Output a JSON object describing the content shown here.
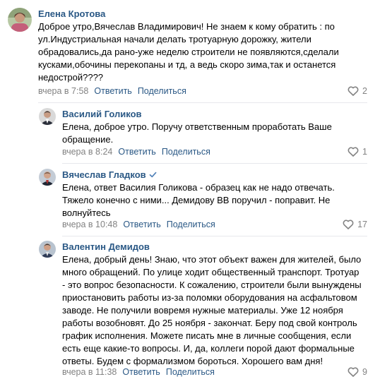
{
  "comments": [
    {
      "author": "Елена Кротова",
      "lines": [
        "Доброе утро,Вячеслав Владимирович! Не знаем к кому обратить : по",
        "ул.Индустриальная начали делать тротуарную дорожку, жители",
        "обрадовались,да рано-уже неделю строители не появляются,сделали",
        "кусками,обочины перекопаны и тд, а ведь скоро зима,так и останется",
        "недострой????"
      ],
      "time": "вчера в 7:58",
      "reply_label": "Ответить",
      "share_label": "Поделиться",
      "likes": "2"
    },
    {
      "author": "Василий Голиков",
      "lines": [
        "Елена, доброе утро. Поручу ответственным проработать Ваше",
        "обращение."
      ],
      "time": "вчера в 8:24",
      "reply_label": "Ответить",
      "share_label": "Поделиться",
      "likes": "1"
    },
    {
      "author": "Вячеслав Гладков",
      "lines": [
        "Елена, ответ Василия Голикова - образец как не надо отвечать.",
        "Тяжело конечно с ними... Демидову ВВ поручил - поправит. Не",
        "волнуйтесь"
      ],
      "time": "вчера в 10:48",
      "reply_label": "Ответить",
      "share_label": "Поделиться",
      "likes": "17"
    },
    {
      "author": "Валентин Демидов",
      "lines": [
        "Елена, добрый день! Знаю, что этот объект важен для жителей, было",
        "много обращений. По улице ходит общественный транспорт. Тротуар",
        "- это вопрос безопасности. К сожалению, строители были вынуждены",
        "приостановить работы из-за поломки оборудования на асфальтовом",
        "заводе. Не получили вовремя нужные материалы. Уже 12 ноября",
        "работы возобновят. До 25 ноября - закончат. Беру под свой контроль",
        "график исполнения. Можете писать мне в личные сообщения, если",
        "есть еще какие-то вопросы. И, да, коллеги порой дают формальные",
        "ответы. Будем с формализмом бороться. Хорошего вам дня!"
      ],
      "time": "вчера в 11:38",
      "reply_label": "Ответить",
      "share_label": "Поделиться",
      "likes": "9"
    }
  ],
  "colors": {
    "link": "#2a5885",
    "meta": "#828282",
    "divider": "#e7e8ec",
    "verified": "#5181b8"
  },
  "icons": {
    "like": "heart-icon",
    "verified": "verified-check-icon"
  }
}
